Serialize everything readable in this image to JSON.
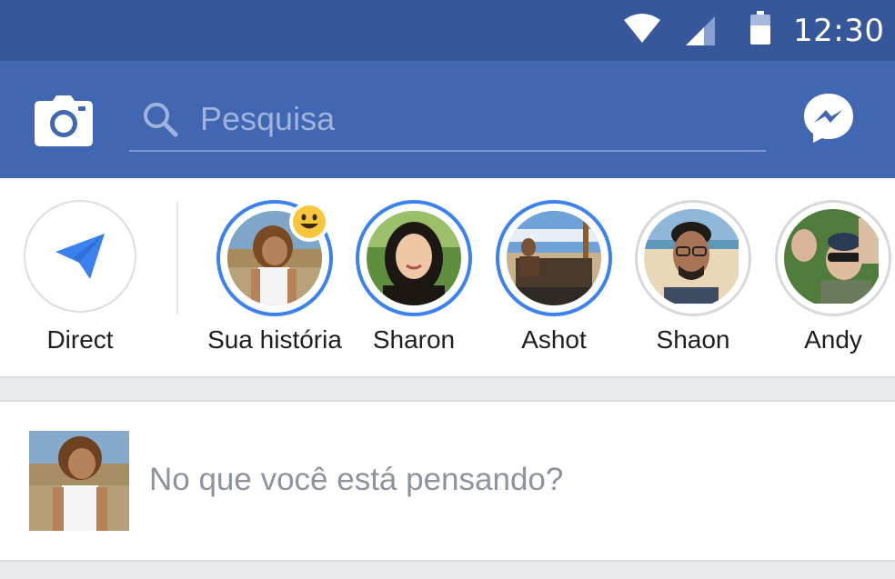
{
  "status_bar": {
    "time": "12:30",
    "icons": [
      "wifi-icon",
      "signal-icon",
      "battery-icon"
    ]
  },
  "header": {
    "search_placeholder": "Pesquisa",
    "left_icon": "camera-icon",
    "right_icon": "messenger-icon"
  },
  "stories": {
    "direct": {
      "label": "Direct",
      "icon": "paper-plane-icon"
    },
    "items": [
      {
        "label": "Sua história",
        "seen": false,
        "badge": "smiley-emoji"
      },
      {
        "label": "Sharon",
        "seen": false
      },
      {
        "label": "Ashot",
        "seen": false
      },
      {
        "label": "Shaon",
        "seen": true
      },
      {
        "label": "Andy",
        "seen": true
      }
    ]
  },
  "composer": {
    "prompt": "No que você está pensando?"
  },
  "colors": {
    "status_bar": "#36589a",
    "header": "#4267b2",
    "story_ring": "#3b82f0",
    "direct_icon": "#3b82f0",
    "prompt_text": "#8d949e"
  }
}
